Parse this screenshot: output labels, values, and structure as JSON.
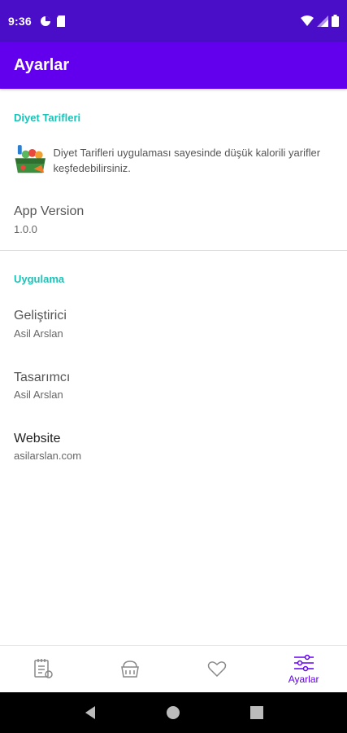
{
  "status": {
    "time": "9:36"
  },
  "appbar": {
    "title": "Ayarlar"
  },
  "sections": {
    "diet": {
      "header": "Diyet Tarifleri",
      "description": "Diyet Tarifleri uygulaması sayesinde düşük kalorili yarifler keşfedebilirsiniz.",
      "version_title": "App Version",
      "version_value": "1.0.0"
    },
    "app": {
      "header": "Uygulama",
      "developer_title": "Geliştirici",
      "developer_value": "Asil Arslan",
      "designer_title": "Tasarımcı",
      "designer_value": "Asil Arslan",
      "website_title": "Website",
      "website_value": "asilarslan.com"
    }
  },
  "bottom_nav": {
    "items": [
      {
        "icon": "recipe-list-icon",
        "label": ""
      },
      {
        "icon": "food-basket-icon",
        "label": ""
      },
      {
        "icon": "heart-icon",
        "label": ""
      },
      {
        "icon": "settings-sliders-icon",
        "label": "Ayarlar",
        "active": true
      }
    ]
  },
  "colors": {
    "primary": "#6200ee",
    "status": "#4a0ec8",
    "accent": "#18c3b8"
  }
}
